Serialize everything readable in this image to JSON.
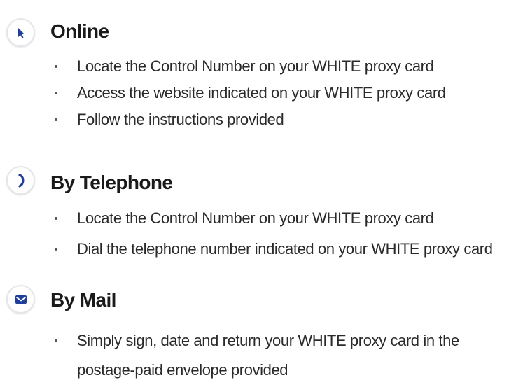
{
  "sections": [
    {
      "icon": "cursor-arrow-icon",
      "title": "Online",
      "items": [
        "Locate the Control Number on your WHITE proxy card",
        "Access the website indicated on your WHITE proxy card",
        "Follow the instructions provided"
      ]
    },
    {
      "icon": "telephone-handset-icon",
      "title": "By Telephone",
      "items": [
        "Locate the Control Number on your WHITE proxy card",
        "Dial the telephone number indicated on your WHITE proxy card"
      ]
    },
    {
      "icon": "envelope-icon",
      "title": "By Mail",
      "items": [
        "Simply sign, date and return your WHITE proxy card in the postage-paid envelope provided"
      ]
    }
  ],
  "colors": {
    "icon_blue": "#1e3f9a",
    "text": "#2a2a2a",
    "icon_ring": "#e4e6ea"
  }
}
